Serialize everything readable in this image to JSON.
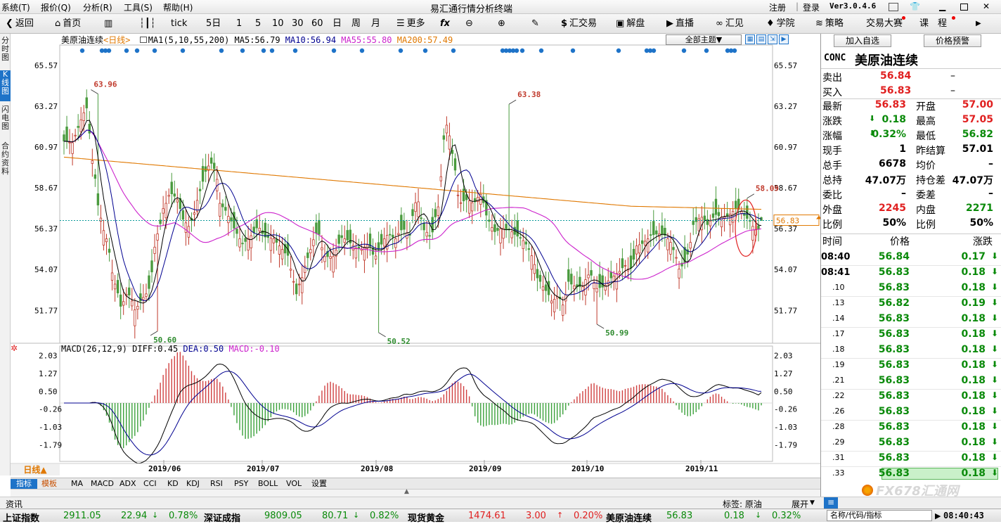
{
  "app": {
    "title": "易汇通行情分析终端",
    "version": "Ver3.0.4.6"
  },
  "menu": [
    "系统(T)",
    "报价(Q)",
    "分析(R)",
    "工具(S)",
    "帮助(H)"
  ],
  "auth": {
    "register": "注册",
    "login": "登录"
  },
  "clock": "08:40:43",
  "toolbar": {
    "back": "返回",
    "home": "首页",
    "tick": "tick",
    "periods": [
      "5日",
      "1",
      "5",
      "10",
      "30",
      "60",
      "日",
      "周",
      "月"
    ],
    "more": "更多",
    "trade": "汇交易",
    "analysis": "解盘",
    "live": "直播",
    "huijian": "汇见",
    "school": "学院",
    "strategy": "策略",
    "contest": "交易大赛",
    "course": "课　程"
  },
  "side_tabs": [
    "分时图",
    "K线图",
    "闪电图",
    "合约资料"
  ],
  "chart": {
    "symbol": "美原油连续",
    "period": "<日线>",
    "ma_header": "MA1(5,10,55,200)",
    "ma5": "MA5:56.79",
    "ma10": "MA10:56.94",
    "ma55": "MA55:55.80",
    "ma200": "MA200:57.49",
    "theme_select": "全部主题▼",
    "price_ticks": [
      "65.57",
      "63.27",
      "60.97",
      "58.67",
      "56.37",
      "54.07",
      "51.77"
    ],
    "current_price_label": "56.83",
    "annotations": [
      "63.96",
      "63.38",
      "58.09",
      "50.60",
      "50.52",
      "50.99"
    ],
    "macd_header": "MACD(26,12,9)",
    "diff": "DIFF:0.45",
    "dea": "DEA:0.50",
    "macd": "MACD:-0.10",
    "macd_ticks": [
      "2.03",
      "1.27",
      "0.50",
      "-0.26",
      "-1.03",
      "-1.79"
    ],
    "months": [
      "2019/06",
      "2019/07",
      "2019/08",
      "2019/09",
      "2019/10",
      "2019/11"
    ],
    "period_label": "日线▲",
    "colors": {
      "up": "#c0392b",
      "down": "#4a9b3e",
      "ma5": "#000000",
      "ma10": "#000090",
      "ma55": "#cc22cc",
      "ma200": "#e07800"
    }
  },
  "chart_data": {
    "type": "candlestick",
    "title": "美原油连续 <日线>",
    "ylim": [
      50.0,
      66.0
    ],
    "x_months": [
      "2019/06",
      "2019/07",
      "2019/08",
      "2019/09",
      "2019/10",
      "2019/11"
    ],
    "marked_high_low": {
      "high_may": 63.96,
      "low_jun": 50.6,
      "low_aug": 50.52,
      "high_sep": 63.38,
      "low_oct": 50.99,
      "high_nov": 58.09
    },
    "last": {
      "price": 56.83,
      "ma5": 56.79,
      "ma10": 56.94,
      "ma55": 55.8,
      "ma200": 57.49
    },
    "macd": {
      "diff": 0.45,
      "dea": 0.5,
      "macd": -0.1,
      "ylim": [
        -2.2,
        2.2
      ]
    }
  },
  "bottom_tabs": [
    "指标",
    "模板",
    "MA",
    "MACD",
    "ADX",
    "CCI",
    "KD",
    "KDJ",
    "RSI",
    "PSY",
    "BOLL",
    "VOL",
    "设置"
  ],
  "panel": {
    "add_watch": "加入自选",
    "price_alert": "价格预警",
    "code": "CONC",
    "name": "美原油连续",
    "sell_label": "卖出",
    "sell": "56.84",
    "sell_dash": "–",
    "buy_label": "买入",
    "buy": "56.83",
    "buy_dash": "–",
    "rows": [
      [
        "最新",
        "56.83",
        "开盘",
        "57.00"
      ],
      [
        "涨跌",
        "0.18",
        "最高",
        "57.05"
      ],
      [
        "涨幅",
        "0.32%",
        "最低",
        "56.82"
      ],
      [
        "现手",
        "1",
        "昨结算",
        "57.01"
      ],
      [
        "总手",
        "6678",
        "均价",
        "–"
      ],
      [
        "总持",
        "47.07万",
        "持仓差",
        "47.07万"
      ],
      [
        "委比",
        "–",
        "委差",
        "–"
      ],
      [
        "外盘",
        "2245",
        "内盘",
        "2271"
      ],
      [
        "比例",
        "50%",
        "比例",
        "50%"
      ]
    ],
    "trade_header": [
      "时间",
      "价格",
      "涨跌"
    ],
    "trades": [
      [
        "08:40",
        "56.84",
        "0.17"
      ],
      [
        "08:41",
        "56.83",
        "0.18"
      ],
      [
        ".10",
        "56.83",
        "0.18"
      ],
      [
        ".13",
        "56.82",
        "0.19"
      ],
      [
        ".14",
        "56.83",
        "0.18"
      ],
      [
        ".17",
        "56.83",
        "0.18"
      ],
      [
        ".18",
        "56.83",
        "0.18"
      ],
      [
        ".19",
        "56.83",
        "0.18"
      ],
      [
        ".21",
        "56.83",
        "0.18"
      ],
      [
        ".22",
        "56.83",
        "0.18"
      ],
      [
        ".26",
        "56.83",
        "0.18"
      ],
      [
        ".28",
        "56.83",
        "0.18"
      ],
      [
        ".29",
        "56.83",
        "0.18"
      ],
      [
        ".31",
        "56.83",
        "0.18"
      ],
      [
        ".33",
        "56.83",
        "0.18"
      ]
    ]
  },
  "info": {
    "zixun": "资讯",
    "tag": "标签: 原油",
    "expand": "展开",
    "collapse": "≡",
    "search_placeholder": "名称/代码/指标"
  },
  "ticker": [
    {
      "name": "上证指数",
      "price": "2911.05",
      "chg": "22.94",
      "pct": "0.78%",
      "dir": "down"
    },
    {
      "name": "深证成指",
      "price": "9809.05",
      "chg": "80.71",
      "pct": "0.82%",
      "dir": "down"
    },
    {
      "name": "现货黄金",
      "price": "1474.61",
      "chg": "3.00",
      "pct": "0.20%",
      "dir": "up"
    },
    {
      "name": "美原油连续",
      "price": "56.83",
      "chg": "0.18",
      "pct": "0.32%",
      "dir": "down"
    }
  ],
  "watermark": "FX678汇通网"
}
